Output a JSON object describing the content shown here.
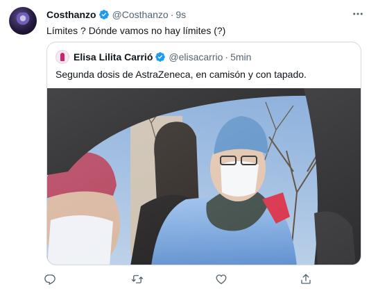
{
  "tweet": {
    "author_name": "Costhanzo",
    "author_handle": "@Costhanzo",
    "separator": "·",
    "time": "9s",
    "text": "Límites ? Dónde vamos no hay límites (?)",
    "verified": true
  },
  "quote": {
    "author_name": "Elisa Lilita Carrió",
    "author_handle": "@elisacarrio",
    "separator": "·",
    "time": "5min",
    "text": "Segunda dosis de AstraZeneca, en camisón y con tapado.",
    "verified": true
  },
  "actions": [
    {
      "icon": "reply-icon"
    },
    {
      "icon": "retweet-icon"
    },
    {
      "icon": "like-icon"
    },
    {
      "icon": "share-icon"
    }
  ],
  "colors": {
    "verified": "#1d9bf0",
    "icon_gray": "#536471",
    "border": "#cfd9de"
  }
}
